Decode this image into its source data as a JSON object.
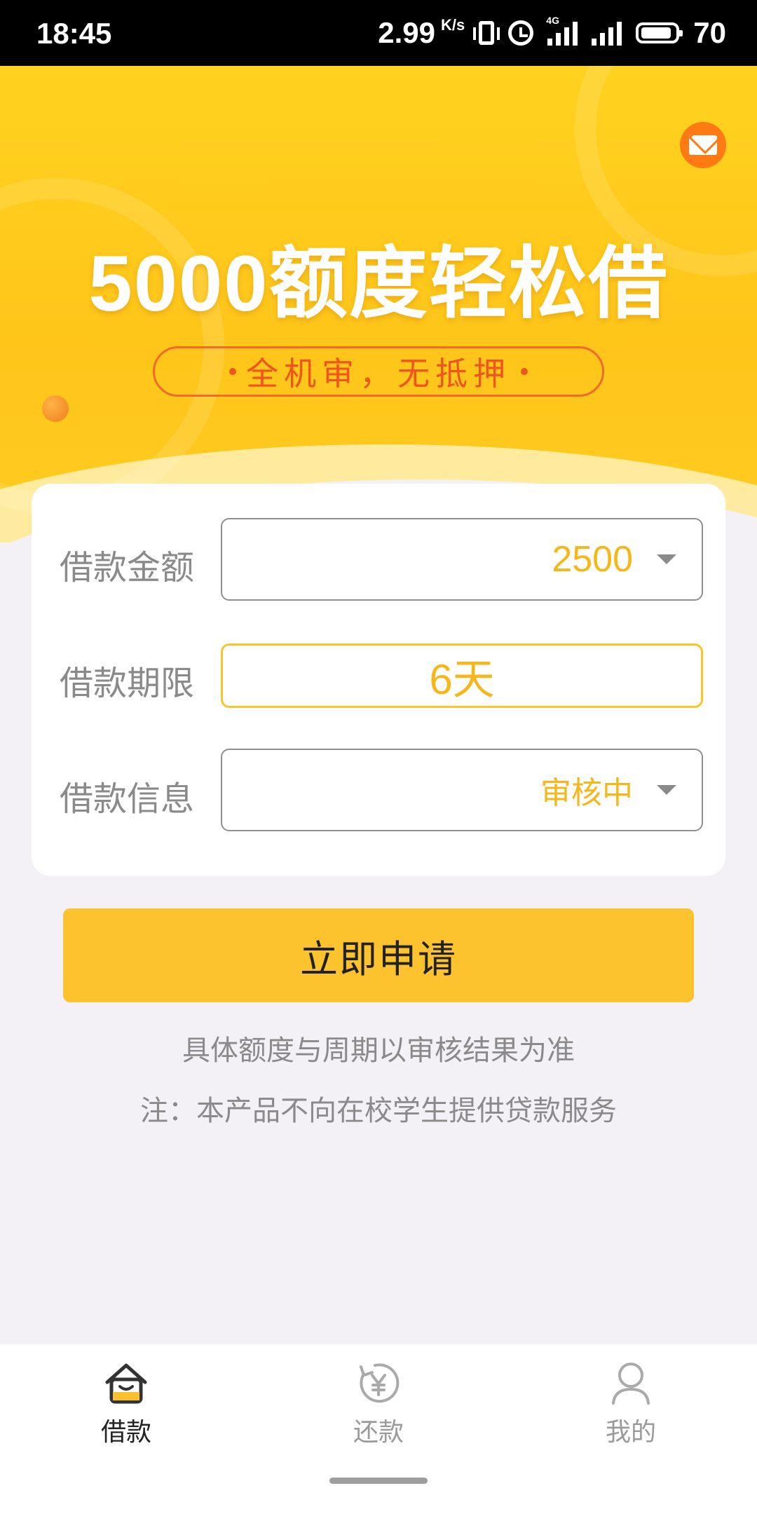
{
  "status_bar": {
    "time": "18:45",
    "net_speed": "2.99",
    "net_unit": "K/s",
    "network_type": "4G",
    "battery": "70"
  },
  "banner": {
    "headline": "5000额度轻松借",
    "tagline": "全机审，无抵押",
    "accent_color": "#ffc51a"
  },
  "form": {
    "amount": {
      "label": "借款金额",
      "value": "2500"
    },
    "term": {
      "label": "借款期限",
      "value": "6天"
    },
    "info": {
      "label": "借款信息",
      "value": "审核中"
    }
  },
  "apply_button": "立即申请",
  "notes": {
    "line1": "具体额度与周期以审核结果为准",
    "line2": "注：本产品不向在校学生提供贷款服务"
  },
  "tabs": [
    {
      "label": "借款",
      "icon": "house-smile-icon",
      "active": true
    },
    {
      "label": "还款",
      "icon": "yen-refresh-icon",
      "active": false
    },
    {
      "label": "我的",
      "icon": "user-icon",
      "active": false
    }
  ]
}
